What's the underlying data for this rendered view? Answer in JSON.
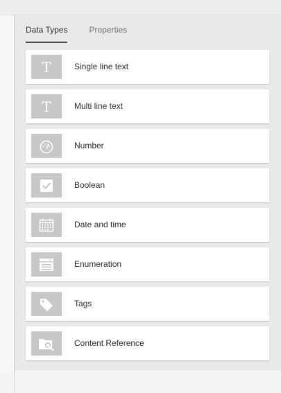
{
  "tabs": [
    {
      "label": "Data Types",
      "active": true
    },
    {
      "label": "Properties",
      "active": false
    }
  ],
  "data_types": [
    {
      "label": "Single line text",
      "icon": "text-t-icon"
    },
    {
      "label": "Multi line text",
      "icon": "text-t-icon"
    },
    {
      "label": "Number",
      "icon": "gauge-icon"
    },
    {
      "label": "Boolean",
      "icon": "checkbox-icon"
    },
    {
      "label": "Date and time",
      "icon": "calendar-icon"
    },
    {
      "label": "Enumeration",
      "icon": "dropdown-list-icon"
    },
    {
      "label": "Tags",
      "icon": "tag-icon"
    },
    {
      "label": "Content Reference",
      "icon": "folder-search-icon"
    }
  ],
  "colors": {
    "panel_bg": "#e9e9e9",
    "card_bg": "#ffffff",
    "thumb_bg": "#c8c8c8",
    "text": "#2c2c2c",
    "tab_inactive": "#6e6e6e"
  }
}
